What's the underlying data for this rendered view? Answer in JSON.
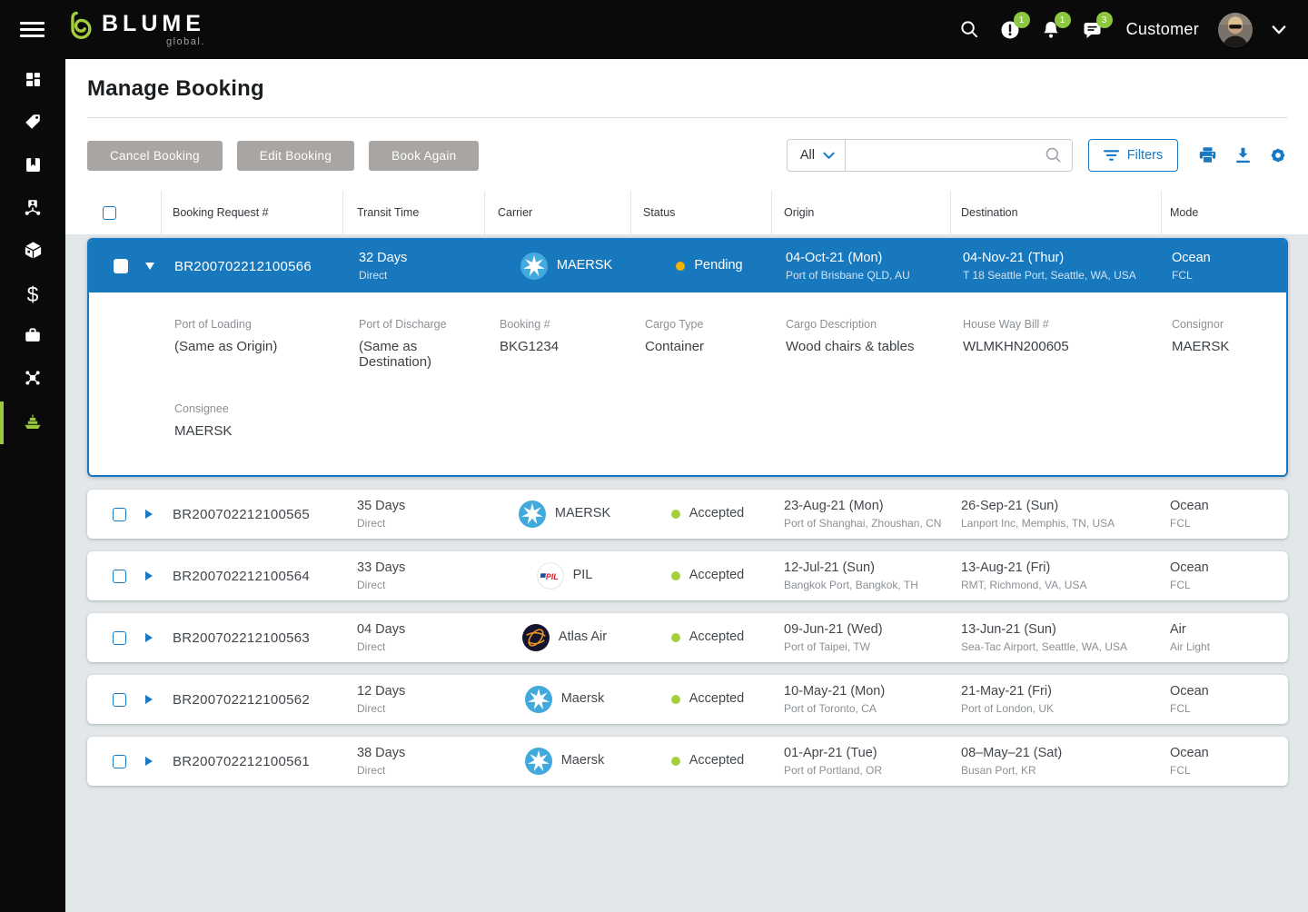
{
  "colors": {
    "accent_blue": "#1779c4",
    "selected_row": "#1878be",
    "pending": "#f2b200",
    "accepted": "#a6ce39",
    "brand_green": "#9aca3c"
  },
  "topbar": {
    "brand": "BLUME",
    "brand_sub": "global.",
    "user_label": "Customer",
    "badges": {
      "alerts": "1",
      "notifications": "1",
      "messages": "3"
    }
  },
  "page": {
    "title": "Manage Booking"
  },
  "toolbar": {
    "cancel_label": "Cancel Booking",
    "edit_label": "Edit Booking",
    "book_again_label": "Book Again",
    "scope_value": "All",
    "search_placeholder": "",
    "filters_label": "Filters"
  },
  "table": {
    "headers": [
      "Booking Request #",
      "Transit Time",
      "Carrier",
      "Status",
      "Origin",
      "Destination",
      "Mode"
    ],
    "rows": [
      {
        "id": "BR200702212100566",
        "transit": "32 Days",
        "transit_sub": "Direct",
        "carrier": "MAERSK",
        "carrier_logo": "maersk-logo",
        "status": "Pending",
        "origin_date": "04-Oct-21 (Mon)",
        "origin_place": "Port of Brisbane QLD, AU",
        "dest_date": "04-Nov-21 (Thur)",
        "dest_place": "T 18 Seattle Port, Seattle, WA, USA",
        "mode": "Ocean",
        "mode_sub": "FCL"
      },
      {
        "id": "BR200702212100565",
        "transit": "35 Days",
        "transit_sub": "Direct",
        "carrier": "MAERSK",
        "carrier_logo": "maersk-logo",
        "status": "Accepted",
        "origin_date": "23-Aug-21 (Mon)",
        "origin_place": "Port of Shanghai, Zhoushan, CN",
        "dest_date": "26-Sep-21 (Sun)",
        "dest_place": "Lanport Inc, Memphis, TN, USA",
        "mode": "Ocean",
        "mode_sub": "FCL"
      },
      {
        "id": "BR200702212100564",
        "transit": "33 Days",
        "transit_sub": "Direct",
        "carrier": "PIL",
        "carrier_logo": "pil-logo",
        "status": "Accepted",
        "origin_date": "12-Jul-21 (Sun)",
        "origin_place": "Bangkok Port, Bangkok, TH",
        "dest_date": "13-Aug-21 (Fri)",
        "dest_place": "RMT, Richmond, VA, USA",
        "mode": "Ocean",
        "mode_sub": "FCL"
      },
      {
        "id": "BR200702212100563",
        "transit": "04 Days",
        "transit_sub": "Direct",
        "carrier": "Atlas Air",
        "carrier_logo": "atlas-air-logo",
        "status": "Accepted",
        "origin_date": "09-Jun-21 (Wed)",
        "origin_place": "Port of Taipei, TW",
        "dest_date": "13-Jun-21 (Sun)",
        "dest_place": "Sea-Tac Airport, Seattle, WA, USA",
        "mode": "Air",
        "mode_sub": "Air Light"
      },
      {
        "id": "BR200702212100562",
        "transit": "12 Days",
        "transit_sub": "Direct",
        "carrier": "Maersk",
        "carrier_logo": "maersk-logo",
        "status": "Accepted",
        "origin_date": "10-May-21 (Mon)",
        "origin_place": "Port of Toronto, CA",
        "dest_date": "21-May-21 (Fri)",
        "dest_place": "Port of London, UK",
        "mode": "Ocean",
        "mode_sub": "FCL"
      },
      {
        "id": "BR200702212100561",
        "transit": "38 Days",
        "transit_sub": "Direct",
        "carrier": "Maersk",
        "carrier_logo": "maersk-logo",
        "status": "Accepted",
        "origin_date": "01-Apr-21 (Tue)",
        "origin_place": "Port of Portland, OR",
        "dest_date": "08–May–21 (Sat)",
        "dest_place": "Busan Port, KR",
        "mode": "Ocean",
        "mode_sub": "FCL"
      }
    ]
  },
  "details": {
    "fields": [
      {
        "label": "Port of Loading",
        "value": "(Same as Origin)"
      },
      {
        "label": "Port of Discharge",
        "value": "(Same as Destination)"
      },
      {
        "label": "Booking #",
        "value": "BKG1234"
      },
      {
        "label": "Cargo Type",
        "value": "Container"
      },
      {
        "label": "Cargo Description",
        "value": "Wood chairs & tables"
      },
      {
        "label": "House Way Bill #",
        "value": "WLMKHN200605"
      },
      {
        "label": "Consignor",
        "value": "MAERSK"
      },
      {
        "label": "Consignee",
        "value": "MAERSK"
      }
    ]
  }
}
